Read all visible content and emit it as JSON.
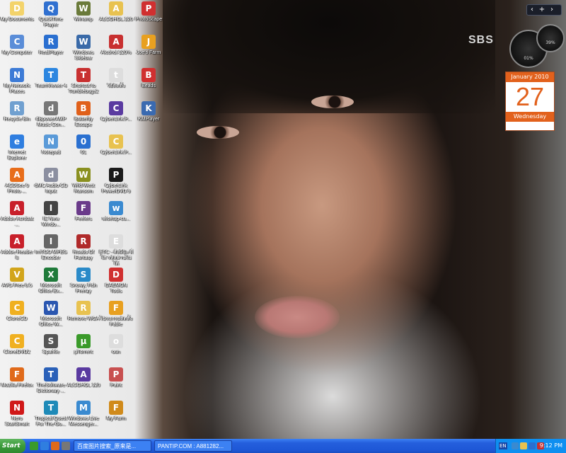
{
  "desktop": {
    "icons": [
      {
        "label": "My Documents",
        "color": "#f3d36b",
        "glyph": "D"
      },
      {
        "label": "My Computer",
        "color": "#5a8dd8",
        "glyph": "C"
      },
      {
        "label": "My Network Places",
        "color": "#3d7bd6",
        "glyph": "N"
      },
      {
        "label": "Recycle Bin",
        "color": "#70a0d0",
        "glyph": "R"
      },
      {
        "label": "Internet Explorer",
        "color": "#2f7ee0",
        "glyph": "e"
      },
      {
        "label": "ACDSee 9 Photo ...",
        "color": "#e86d1a",
        "glyph": "A"
      },
      {
        "label": "Adobe Acrobat ...",
        "color": "#c8202a",
        "glyph": "A"
      },
      {
        "label": "Adobe Reader 8",
        "color": "#c8202a",
        "glyph": "A"
      },
      {
        "label": "AVG Free 8.5",
        "color": "#d2a51b",
        "glyph": "V"
      },
      {
        "label": "CloneCD",
        "color": "#f0b020",
        "glyph": "C"
      },
      {
        "label": "CloneDVD2",
        "color": "#f0b020",
        "glyph": "C"
      },
      {
        "label": "Mozilla Firefox",
        "color": "#e06a1a",
        "glyph": "F"
      },
      {
        "label": "Nero StartSmart",
        "color": "#d01818",
        "glyph": "N"
      },
      {
        "label": "QuickTime Player",
        "color": "#3070d0",
        "glyph": "Q"
      },
      {
        "label": "RealPlayer",
        "color": "#2a6fd0",
        "glyph": "R"
      },
      {
        "label": "TeamViewer 4",
        "color": "#2c86e0",
        "glyph": "T"
      },
      {
        "label": "dBpowerAMP Music Con...",
        "color": "#777",
        "glyph": "d"
      },
      {
        "label": "Notepad",
        "color": "#5a9ad8",
        "glyph": "N"
      },
      {
        "label": "dMC Audio CD Input",
        "color": "#8b8fa0",
        "glyph": "d"
      },
      {
        "label": "IE New Windo...",
        "color": "#444",
        "glyph": "I"
      },
      {
        "label": "ImTOO MPEG Encoder",
        "color": "#666",
        "glyph": "I"
      },
      {
        "label": "Microsoft Office Ex...",
        "color": "#1f7a3a",
        "glyph": "X"
      },
      {
        "label": "Microsoft Office W...",
        "color": "#2a56b0",
        "glyph": "W"
      },
      {
        "label": "Sparkle",
        "color": "#555",
        "glyph": "S"
      },
      {
        "label": "TheSoftware Dictionary ...",
        "color": "#2a60b8",
        "glyph": "T"
      },
      {
        "label": "Tropical Quest For The Go...",
        "color": "#1e8ab8",
        "glyph": "T"
      },
      {
        "label": "Winamp",
        "color": "#6a7a3a",
        "glyph": "W"
      },
      {
        "label": "Windows Sidebar",
        "color": "#3a6aa8",
        "glyph": "W"
      },
      {
        "label": "Shortcut to Tumblebugs2",
        "color": "#c83030",
        "glyph": "T"
      },
      {
        "label": "Butterfly Escape",
        "color": "#e0601a",
        "glyph": "B"
      },
      {
        "label": "01",
        "color": "#2a70d0",
        "glyph": "0"
      },
      {
        "label": "Wild West Ransom",
        "color": "#8a9020",
        "glyph": "W"
      },
      {
        "label": "Feelers",
        "color": "#6a3a8a",
        "glyph": "F"
      },
      {
        "label": "Roads Of Fantasy",
        "color": "#b02a2a",
        "glyph": "R"
      },
      {
        "label": "Snowy, Fish Frenzy",
        "color": "#2a8ac8",
        "glyph": "S"
      },
      {
        "label": "Remove WGA",
        "color": "#e8c250",
        "glyph": "R"
      },
      {
        "label": "µTorrent",
        "color": "#3a9a2a",
        "glyph": "µ"
      },
      {
        "label": "ALCOHOL 120",
        "color": "#5a3aa0",
        "glyph": "A"
      },
      {
        "label": "Windows Live Messenger...",
        "color": "#3a8ad0",
        "glyph": "M"
      },
      {
        "label": "ALCOHOL.120",
        "color": "#e8c250",
        "glyph": "A"
      },
      {
        "label": "Alcohol 120%",
        "color": "#c83030",
        "glyph": "A"
      },
      {
        "label": "วิธีติดตั้ง",
        "color": "#ddd",
        "glyph": "t"
      },
      {
        "label": "CyberLink.P...",
        "color": "#5a3aa0",
        "glyph": "C"
      },
      {
        "label": "CyberLink.P...",
        "color": "#e8c250",
        "glyph": "C"
      },
      {
        "label": "CyberLink PowerDVD 9",
        "color": "#1a1a1a",
        "glyph": "P"
      },
      {
        "label": "wlsetup-cu...",
        "color": "#3a8ad0",
        "glyph": "w"
      },
      {
        "label": "ETC - สั่งมีปัล ที่ใส่ รหัสผ่านไม่ได้",
        "color": "#ddd",
        "glyph": "E"
      },
      {
        "label": "DAEMON Tools",
        "color": "#d03030",
        "glyph": "D"
      },
      {
        "label": "โปรแกรมติดตั้ง Fable",
        "color": "#e8a020",
        "glyph": "F"
      },
      {
        "label": "oun",
        "color": "#ddd",
        "glyph": "o"
      },
      {
        "label": "Paint",
        "color": "#c85050",
        "glyph": "P"
      },
      {
        "label": "My Farm",
        "color": "#d08a1a",
        "glyph": "F"
      },
      {
        "label": "PhotoScape",
        "color": "#d03030",
        "glyph": "P"
      },
      {
        "label": "Joe's Farm",
        "color": "#e8a020",
        "glyph": "J"
      },
      {
        "label": "Beads",
        "color": "#d03030",
        "glyph": "B"
      },
      {
        "label": "KMPlayer",
        "color": "#3a6ab0",
        "glyph": "K"
      }
    ]
  },
  "watermark": "SBS",
  "gadget_toolbar": {
    "prev": "‹",
    "add": "+",
    "next": "›"
  },
  "calendar": {
    "month": "January 2010",
    "day": "27",
    "weekday": "Wednesday"
  },
  "gauges": {
    "cpu": "01%",
    "mem": "39%"
  },
  "taskbar": {
    "start_label": "Start",
    "tasks": [
      {
        "label": "百度图片搜索_原来是..."
      },
      {
        "label": "PANTIP.COM : A881282..."
      }
    ],
    "language": "EN",
    "clock": "9:12 PM"
  }
}
